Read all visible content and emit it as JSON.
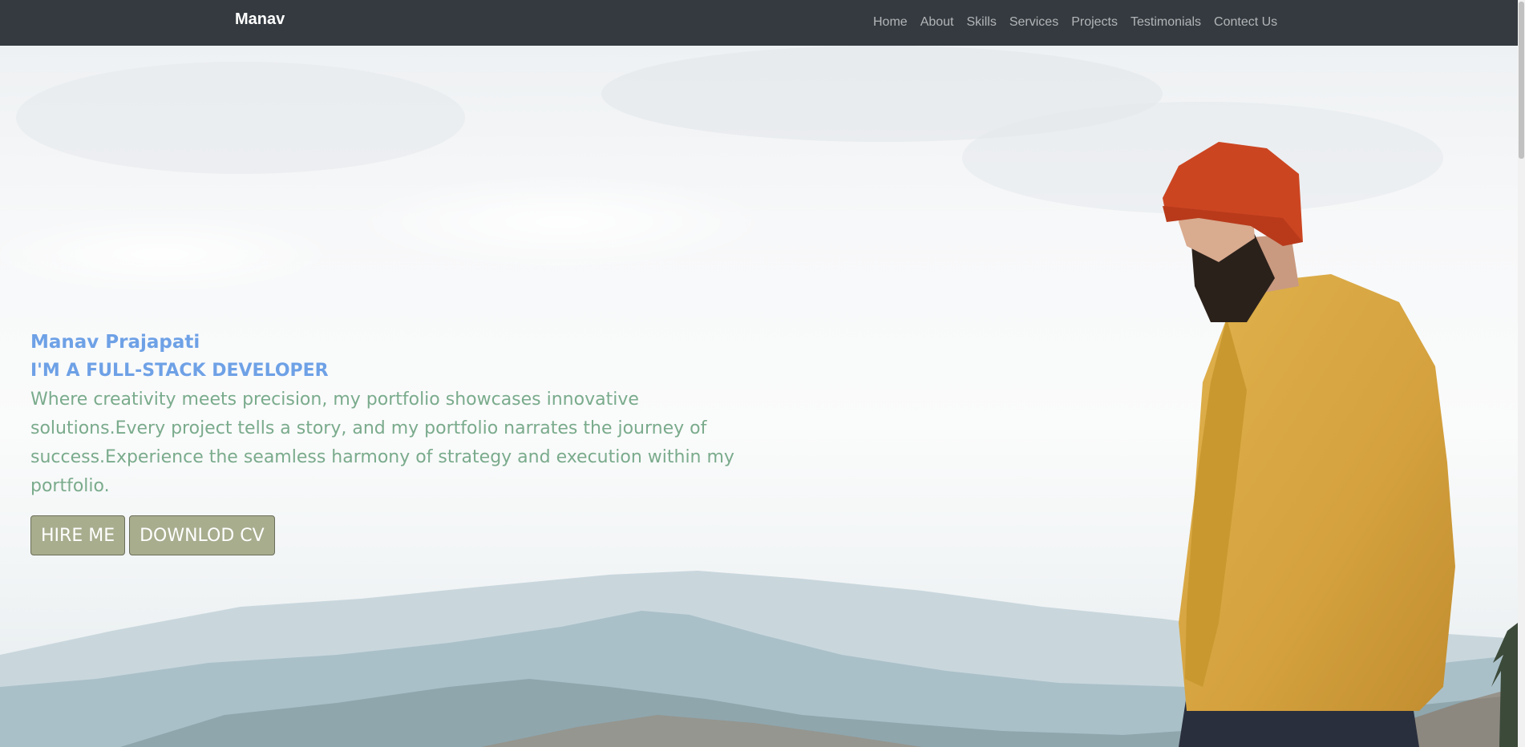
{
  "nav": {
    "brand": "Manav",
    "links": [
      "Home",
      "About",
      "Skills",
      "Services",
      "Projects",
      "Testimonials",
      "Contect Us"
    ]
  },
  "hero": {
    "name": "Manav Prajapati",
    "title": "I'M A FULL-STACK DEVELOPER",
    "description": "Where creativity meets precision, my portfolio showcases innovative solutions.Every project tells a story, and my portfolio narrates the journey of success.Experience the seamless harmony of strategy and execution within my portfolio.",
    "buttons": {
      "hire": "HIRE ME",
      "cv": "DOWNLOD CV"
    }
  },
  "colors": {
    "navbar_bg": "#343a40",
    "heading_blue": "#6ea1e6",
    "text_green": "#7aab8c",
    "button_bg": "#a8ad8e"
  }
}
